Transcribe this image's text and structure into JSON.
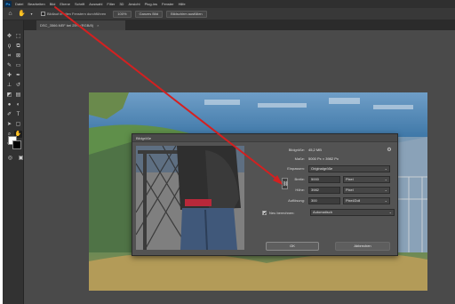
{
  "menu": {
    "items": [
      "Datei",
      "Bearbeiten",
      "Bild",
      "Ebene",
      "Schrift",
      "Auswahl",
      "Filter",
      "3D",
      "Ansicht",
      "Plug-ins",
      "Fenster",
      "Hilfe"
    ]
  },
  "options": {
    "scroll_all_windows": "Bildlauf in allen Fenstern durchführen",
    "zoom_100": "100%",
    "fit_screen": "Ganzes Bild",
    "fill_screen": "Bildschirm ausfüllen"
  },
  "document": {
    "tab_title": "DSC_3566.NEF bei 25% (RGB/8)"
  },
  "colors": {
    "foreground": "#ffffff",
    "background": "#000000",
    "annotation_arrow": "#d42020"
  },
  "dialog": {
    "title": "Bildgröße",
    "image_size_label": "Bildgröße:",
    "image_size_value": "45,2 MB",
    "dimensions_label": "Maße:",
    "dimensions_value": "5000 Px × 3982 Px",
    "fit_to_label": "Einpassen:",
    "fit_to_value": "Originalgröße",
    "width_label": "Breite:",
    "width_value": "5000",
    "width_unit": "Pixel",
    "height_label": "Höhe:",
    "height_value": "3982",
    "height_unit": "Pixel",
    "resolution_label": "Auflösung:",
    "resolution_value": "300",
    "resolution_unit": "Pixel/Zoll",
    "resample_label": "Neu berechnen:",
    "resample_value": "Automatisch",
    "ok_label": "OK",
    "cancel_label": "Abbrechen"
  }
}
